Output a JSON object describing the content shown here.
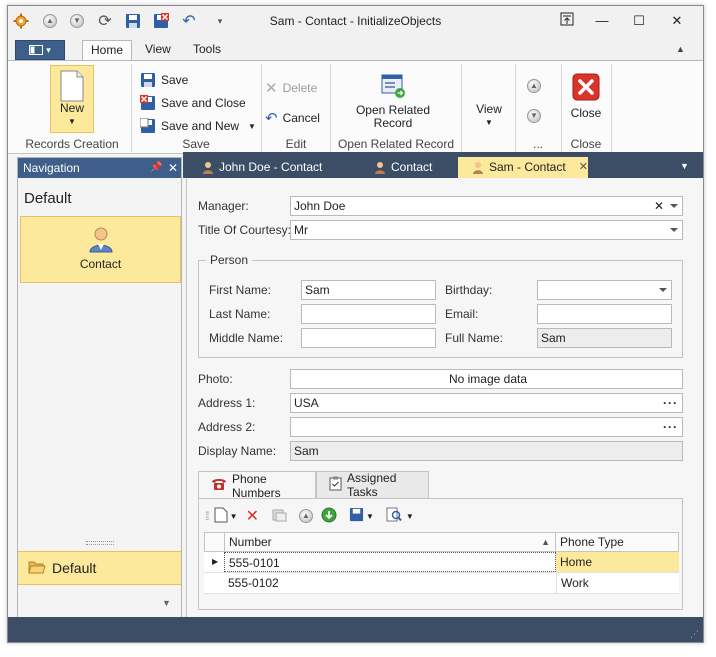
{
  "window": {
    "title": "Sam - Contact - InitializeObjects"
  },
  "ribbon": {
    "tabs": [
      "Home",
      "View",
      "Tools"
    ],
    "active_tab": "Home",
    "groups": {
      "records_creation": {
        "caption": "Records Creation",
        "new_label": "New"
      },
      "save": {
        "caption": "Save",
        "save_label": "Save",
        "save_close_label": "Save and Close",
        "save_new_label": "Save and New"
      },
      "edit": {
        "caption": "Edit",
        "delete_label": "Delete",
        "cancel_label": "Cancel"
      },
      "open_related": {
        "caption": "Open Related Record",
        "open_label": "Open Related Record"
      },
      "view": {
        "view_label": "View"
      },
      "nav": {
        "caption": "..."
      },
      "close": {
        "caption": "Close",
        "close_label": "Close"
      }
    }
  },
  "navigation": {
    "title": "Navigation",
    "group_title": "Default",
    "items": [
      {
        "label": "Contact"
      }
    ],
    "footer_group": "Default"
  },
  "document_tabs": [
    {
      "label": "John Doe - Contact"
    },
    {
      "label": "Contact"
    },
    {
      "label": "Sam - Contact",
      "active": true
    }
  ],
  "form": {
    "manager": {
      "label": "Manager:",
      "value": "John Doe"
    },
    "title_of_courtesy": {
      "label": "Title Of Courtesy:",
      "value": "Mr"
    },
    "person": {
      "caption": "Person",
      "first_name": {
        "label": "First Name:",
        "value": "Sam"
      },
      "last_name": {
        "label": "Last Name:",
        "value": ""
      },
      "middle_name": {
        "label": "Middle Name:",
        "value": ""
      },
      "birthday": {
        "label": "Birthday:",
        "value": ""
      },
      "email": {
        "label": "Email:",
        "value": ""
      },
      "full_name": {
        "label": "Full Name:",
        "value": "Sam"
      }
    },
    "photo": {
      "label": "Photo:",
      "value": "No image data"
    },
    "address1": {
      "label": "Address 1:",
      "value": "USA"
    },
    "address2": {
      "label": "Address 2:",
      "value": ""
    },
    "display_name": {
      "label": "Display Name:",
      "value": "Sam"
    }
  },
  "detail_tabs": [
    {
      "label": "Phone Numbers",
      "active": true
    },
    {
      "label": "Assigned Tasks"
    }
  ],
  "grid": {
    "columns": [
      "Number",
      "Phone Type"
    ],
    "rows": [
      {
        "number": "555-0101",
        "phone_type": "Home"
      },
      {
        "number": "555-0102",
        "phone_type": "Work"
      }
    ]
  },
  "colors": {
    "accent_dark": "#3c4e65",
    "accent_blue": "#3e5f8a",
    "selection": "#fce99c",
    "close_red": "#d9332a"
  }
}
